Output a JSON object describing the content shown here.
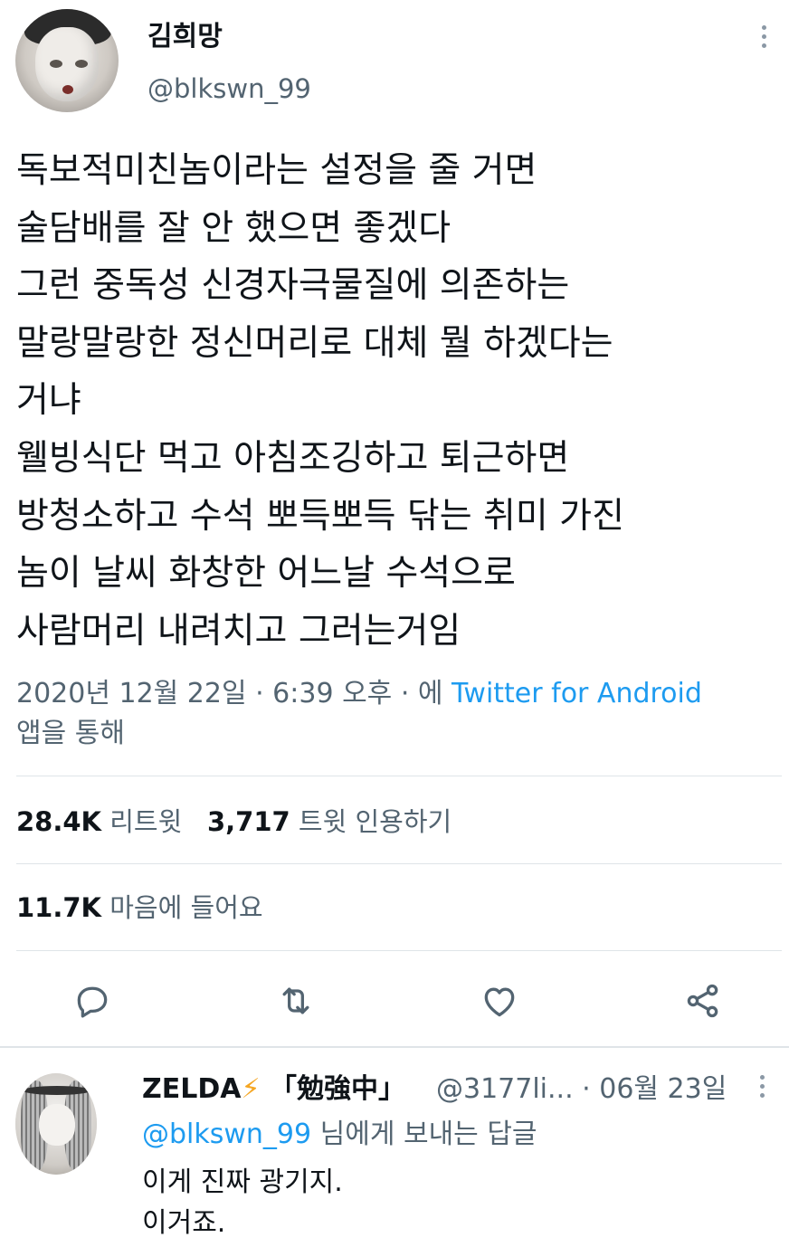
{
  "author": {
    "display_name": "김희망",
    "handle": "@blkswn_99"
  },
  "tweet": {
    "lines": [
      "독보적미친놈이라는 설정을 줄 거면",
      "술담배를 잘 안 했으면 좋겠다",
      "그런 중독성 신경자극물질에 의존하는",
      "말랑말랑한 정신머리로 대체 뭘 하겠다는",
      "거냐",
      "웰빙식단 먹고 아침조깅하고 퇴근하면",
      "방청소하고 수석 뽀득뽀득 닦는 취미 가진",
      "놈이 날씨 화창한 어느날 수석으로",
      "사람머리 내려치고 그러는거임"
    ],
    "timestamp": "2020년 12월 22일 · 6:39 오후 · 에",
    "source": "Twitter for Android",
    "source_suffix": "앱을 통해"
  },
  "stats": {
    "retweets_count": "28.4K",
    "retweets_label": "리트윗",
    "quotes_count": "3,717",
    "quotes_label": "트윗 인용하기",
    "likes_count": "11.7K",
    "likes_label": "마음에 들어요"
  },
  "actions": [
    "reply-icon",
    "retweet-icon",
    "like-icon",
    "share-icon"
  ],
  "reply": {
    "display_name": "ZELDA",
    "name_emoji": "⚡",
    "name_suffix": "「勉強中」",
    "handle_date": "@3177li... · 06월 23일",
    "replying_mention": "@blkswn_99",
    "replying_suffix": " 님에게 보내는 답글",
    "text_lines": [
      "이게 진짜 광기지.",
      "이거죠."
    ]
  },
  "colors": {
    "accent": "#1d9bf0",
    "text": "#0f1419",
    "secondary": "#536471",
    "divider": "#dfe4e8"
  }
}
